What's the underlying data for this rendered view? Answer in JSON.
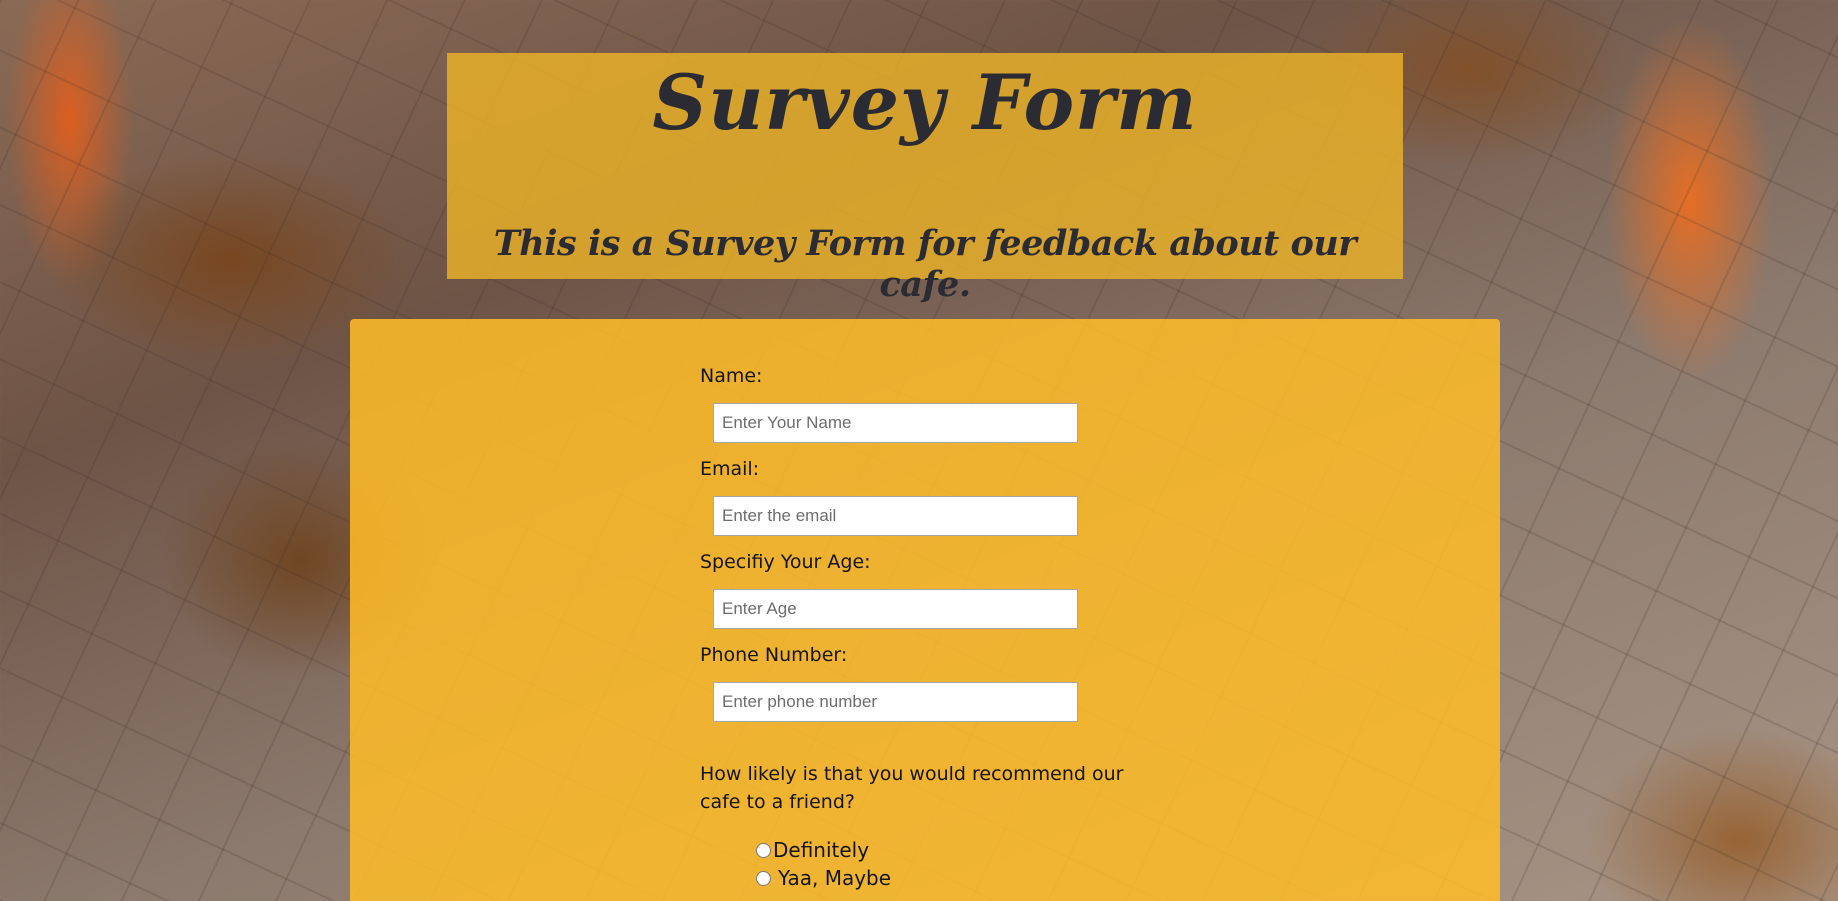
{
  "header": {
    "title": "Survey Form",
    "subtitle": "This is a Survey Form for feedback about our cafe."
  },
  "form": {
    "name_label": "Name:",
    "name_placeholder": "Enter Your Name",
    "email_label": "Email:",
    "email_placeholder": "Enter the email",
    "age_label": "Specifiy Your Age:",
    "age_placeholder": "Enter Age",
    "phone_label": "Phone Number:",
    "phone_placeholder": "Enter phone number",
    "recommend_question": "How likely is that you would recommend our cafe to a friend?",
    "recommend_options": [
      "Definitely",
      "Yaa, Maybe"
    ]
  },
  "colors": {
    "header_bg": "#ECB228",
    "panel_bg": "#FFBC28",
    "text": "#2B2B33"
  }
}
